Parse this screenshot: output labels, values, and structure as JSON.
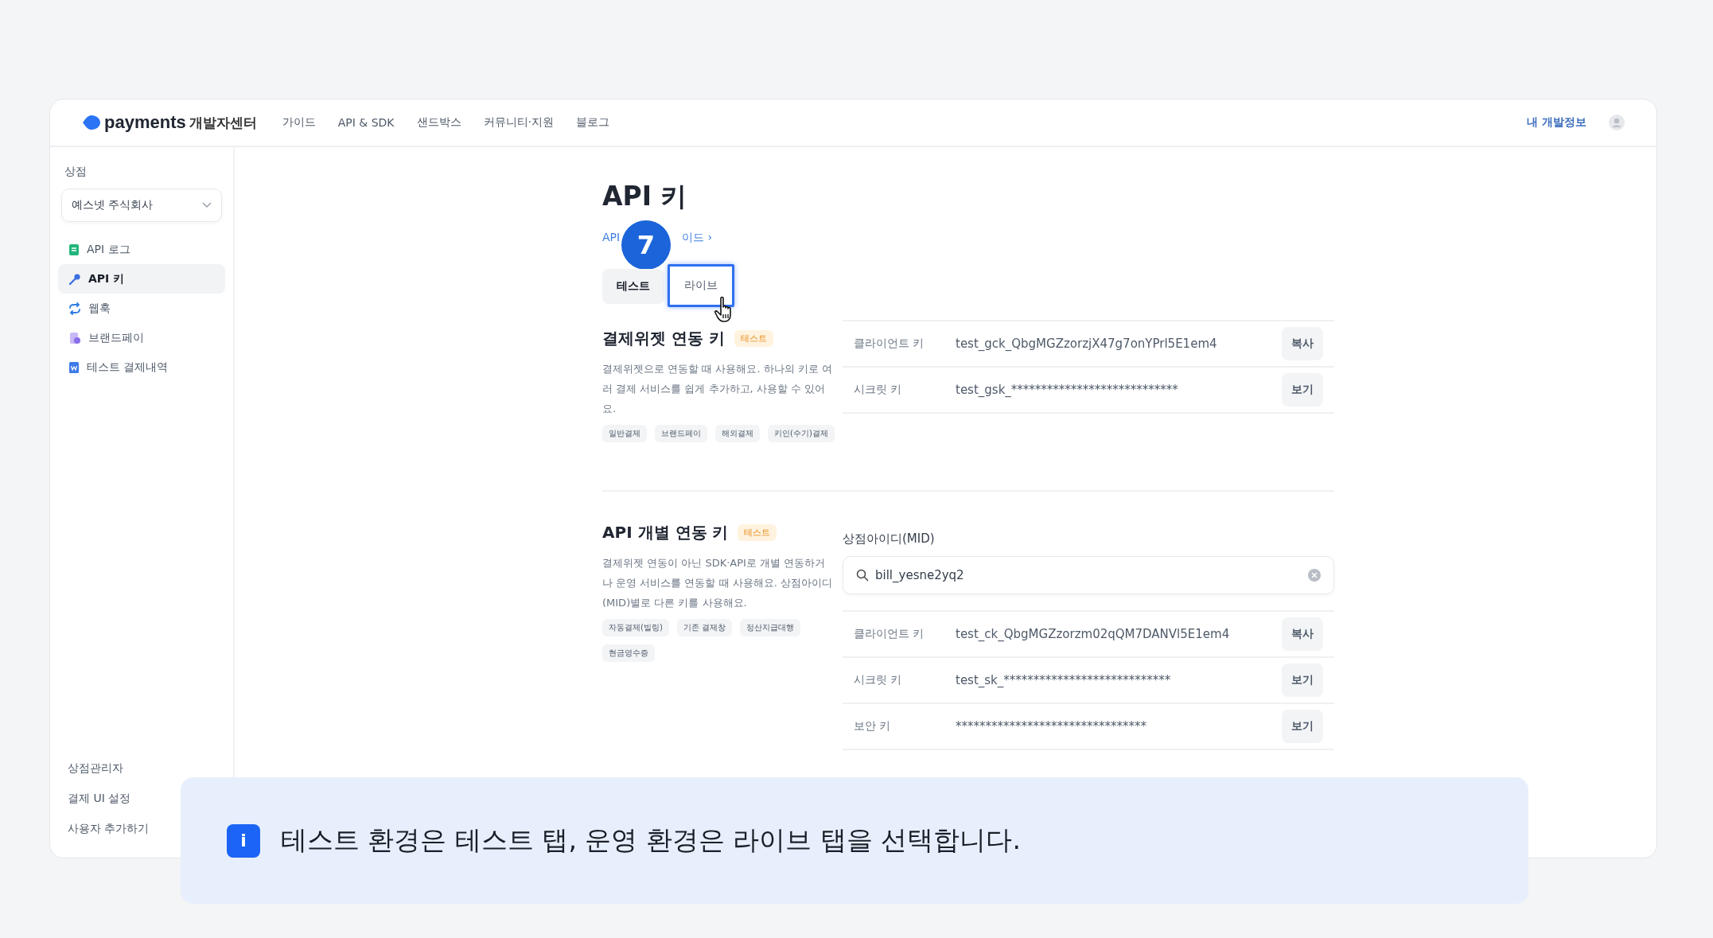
{
  "topnav": {
    "logo_word": "payments",
    "logo_sub": "개발자센터",
    "links": [
      "가이드",
      "API & SDK",
      "샌드박스",
      "커뮤니티·지원",
      "블로그"
    ],
    "account_link": "내 개발정보"
  },
  "sidebar": {
    "section_label": "상점",
    "store_select": {
      "value": "예스넷 주식회사"
    },
    "items": [
      {
        "label": "API 로그",
        "kind": "log",
        "selected": false
      },
      {
        "label": "API 키",
        "kind": "key",
        "selected": true
      },
      {
        "label": "웹훅",
        "kind": "webhook",
        "selected": false
      },
      {
        "label": "브랜드페이",
        "kind": "brandpay",
        "selected": false
      },
      {
        "label": "테스트 결제내역",
        "kind": "history",
        "selected": false
      }
    ],
    "footer_links": [
      "상점관리자",
      "결제 UI 설정",
      "사용자 추가하기"
    ]
  },
  "page": {
    "title": "API 키",
    "guide_link": {
      "start": "API",
      "end": "이드 ›"
    },
    "step_badge": "7",
    "tabs": [
      {
        "label": "테스트",
        "selected": true,
        "highlighted": false
      },
      {
        "label": "라이브",
        "selected": false,
        "highlighted": true
      }
    ],
    "sections": [
      {
        "title": "결제위젯 연동 키",
        "badge": "테스트",
        "description": "결제위젯으로 연동할 때 사용해요. 하나의 키로 여러 결제 서비스를 쉽게 추가하고, 사용할 수 있어요.",
        "tags": [
          "일반결제",
          "브랜드페이",
          "해외결제",
          "키인(수기)결제"
        ],
        "keys": [
          {
            "label": "클라이언트 키",
            "value": "test_gck_QbgMGZzorzjX47g7onYPrl5E1em4",
            "action": "복사"
          },
          {
            "label": "시크릿 키",
            "value": "test_gsk_****************************",
            "action": "보기"
          }
        ]
      },
      {
        "title": "API 개별 연동 키",
        "badge": "테스트",
        "description": "결제위젯 연동이 아닌 SDK·API로 개별 연동하거나 운영 서비스를 연동할 때 사용해요. 상점아이디(MID)별로 다른 키를 사용해요.",
        "tags": [
          "자동결제(빌링)",
          "기존 결제창",
          "정산지급대행",
          "현금영수증"
        ],
        "mid": {
          "label": "상점아이디(MID)",
          "value": "bill_yesne2yq2"
        },
        "keys": [
          {
            "label": "클라이언트 키",
            "value": "test_ck_QbgMGZzorzm02qQM7DANVl5E1em4",
            "action": "복사"
          },
          {
            "label": "시크릿 키",
            "value": "test_sk_****************************",
            "action": "보기"
          },
          {
            "label": "보안 키",
            "value": "********************************",
            "action": "보기"
          }
        ]
      }
    ]
  },
  "callout": {
    "text": "테스트 환경은 테스트 탭, 운영 환경은 라이브 탭을 선택합니다.",
    "icon_glyph": "i"
  }
}
